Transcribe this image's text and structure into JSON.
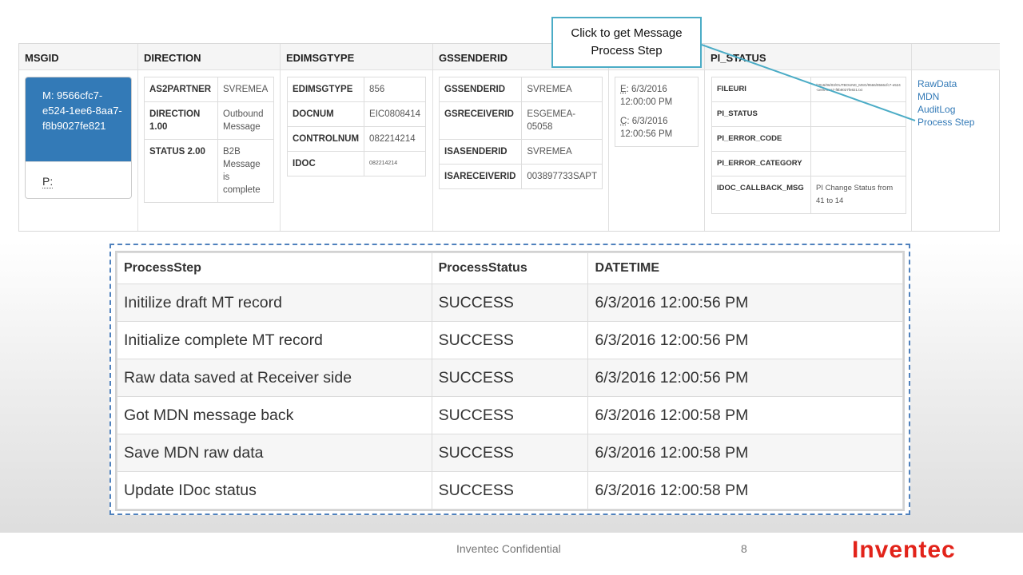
{
  "headers": {
    "msgid": "MSGID",
    "direction": "DIRECTION",
    "edimsgtype": "EDIMSGTYPE",
    "gssenderid": "GSSENDERID",
    "pi_status": "PI_STATUS"
  },
  "msg_card": {
    "m_line": "M: 9566cfc7-e524-1ee6-8aa7-f8b9027fe821",
    "p_label": "P:"
  },
  "direction_table": [
    {
      "k": "AS2PARTNER",
      "v": "SVREMEA"
    },
    {
      "k": "DIRECTION 1.00",
      "v": "Outbound Message"
    },
    {
      "k": "STATUS 2.00",
      "v": "B2B Message is complete"
    }
  ],
  "edi_table": [
    {
      "k": "EDIMSGTYPE",
      "v": "856"
    },
    {
      "k": "DOCNUM",
      "v": "EIC0808414"
    },
    {
      "k": "CONTROLNUM",
      "v": "082214214"
    },
    {
      "k": "IDOC",
      "v": "082214214"
    }
  ],
  "gs_table": [
    {
      "k": "GSSENDERID",
      "v": "SVREMEA"
    },
    {
      "k": "GSRECEIVERID",
      "v": "ESGEMEA-05058"
    },
    {
      "k": "ISASENDERID",
      "v": "SVREMEA"
    },
    {
      "k": "ISARECEIVERID",
      "v": "003897733SAPT"
    }
  ],
  "dates": {
    "e_prefix": "E",
    "e_value": ": 6/3/2016 12:00:00 PM",
    "c_prefix": "C",
    "c_value": ": 6/3/2016 12:00:56 PM"
  },
  "pi_table": [
    {
      "k": "FILEURI",
      "v": "/2016/06/03/OUTBOUND_MSG/9566/9566cfc7-e524-1ee6-8aa7-f8b9027fe821.txt"
    },
    {
      "k": "PI_STATUS",
      "v": ""
    },
    {
      "k": "PI_ERROR_CODE",
      "v": ""
    },
    {
      "k": "PI_ERROR_CATEGORY",
      "v": ""
    },
    {
      "k": "IDOC_CALLBACK_MSG",
      "v": "PI Change Status from 41 to 14"
    }
  ],
  "links": [
    "RawData",
    "MDN",
    "AuditLog",
    "Process Step"
  ],
  "callout": "Click to get Message Process Step",
  "process_table": {
    "headers": [
      "ProcessStep",
      "ProcessStatus",
      "DATETIME"
    ],
    "rows": [
      [
        "Initilize draft MT record",
        "SUCCESS",
        "6/3/2016 12:00:56 PM"
      ],
      [
        "Initialize complete MT record",
        "SUCCESS",
        "6/3/2016 12:00:56 PM"
      ],
      [
        "Raw data saved at Receiver side",
        "SUCCESS",
        "6/3/2016 12:00:56 PM"
      ],
      [
        "Got MDN message back",
        "SUCCESS",
        "6/3/2016 12:00:58 PM"
      ],
      [
        "Save MDN raw data",
        "SUCCESS",
        "6/3/2016 12:00:58 PM"
      ],
      [
        "Update IDoc status",
        "SUCCESS",
        "6/3/2016 12:00:58 PM"
      ]
    ]
  },
  "footer": {
    "confidential": "Inventec Confidential",
    "page": "8",
    "logo": "Inventec"
  },
  "colors": {
    "card_blue": "#337ab7",
    "link_blue": "#337ab7",
    "callout_border": "#4bacc6",
    "dashed_border": "#4f81bd",
    "logo_red": "#e2231a"
  }
}
